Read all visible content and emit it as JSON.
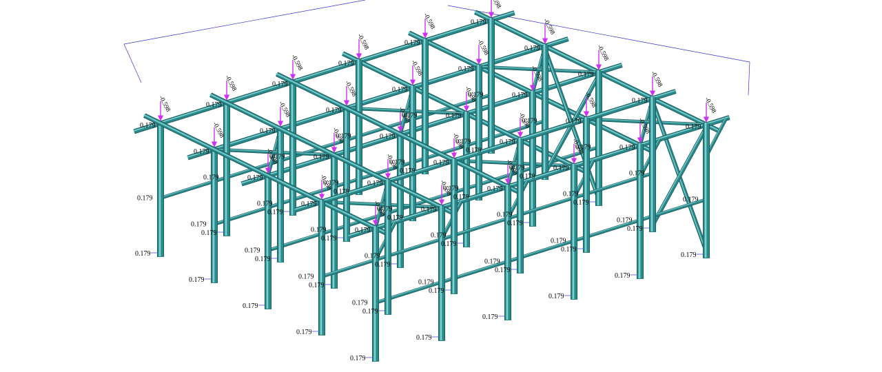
{
  "diagram": {
    "base_load_label": "0.179",
    "top_load_label": "-0.598",
    "member_color": "#2a8a8c",
    "member_highlight": "#7fd0d0",
    "load_arrow_color": "#cc33ee",
    "dimension_line_color": "#3333cc"
  }
}
